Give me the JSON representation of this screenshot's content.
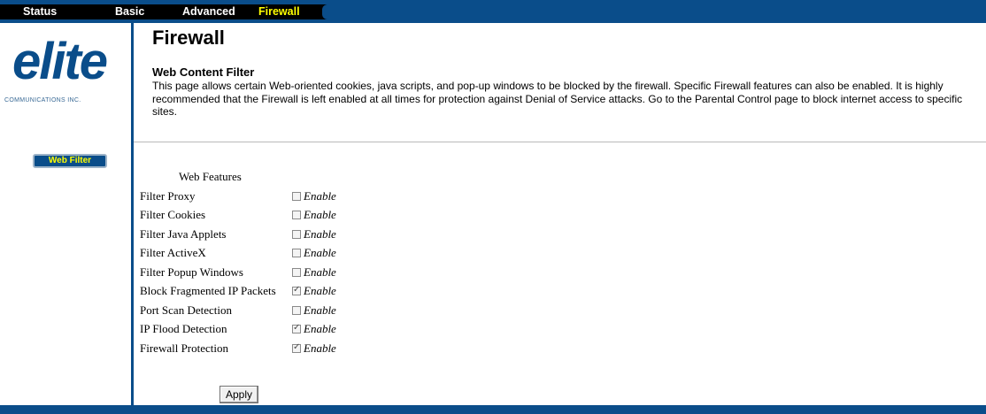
{
  "nav": {
    "tabs": [
      {
        "label": "Status"
      },
      {
        "label": "Basic"
      },
      {
        "label": "Advanced"
      },
      {
        "label": "Firewall"
      }
    ],
    "active_tab": "Firewall"
  },
  "logo": {
    "word": "elite",
    "subtitle": "COMMUNICATIONS INC."
  },
  "sidebar": {
    "items": [
      {
        "label": "Web Filter"
      }
    ]
  },
  "main": {
    "page_title": "Firewall",
    "section_title": "Web Content Filter",
    "section_description": "This page allows certain Web-oriented cookies, java scripts, and pop-up windows to be blocked by the firewall.  Specific Firewall features can also be enabled. It is highly recommended that the Firewall is left enabled at all times for protection against Denial of Service attacks. Go to the Parental Control page to block internet access to specific sites."
  },
  "form": {
    "header": "Web Features",
    "rows": [
      {
        "label": "Filter Proxy",
        "option": "Enable",
        "checked": false
      },
      {
        "label": "Filter Cookies",
        "option": "Enable",
        "checked": false
      },
      {
        "label": "Filter Java Applets",
        "option": "Enable",
        "checked": false
      },
      {
        "label": "Filter ActiveX",
        "option": "Enable",
        "checked": false
      },
      {
        "label": "Filter Popup Windows",
        "option": "Enable",
        "checked": false
      },
      {
        "label": "Block Fragmented IP Packets",
        "option": "Enable",
        "checked": true
      },
      {
        "label": "Port Scan Detection",
        "option": "Enable",
        "checked": false
      },
      {
        "label": "IP Flood Detection",
        "option": "Enable",
        "checked": true
      },
      {
        "label": "Firewall Protection",
        "option": "Enable",
        "checked": true
      }
    ],
    "apply_label": "Apply"
  },
  "colors": {
    "brand_blue": "#0a4d8a",
    "active_tab": "#ffff00",
    "tab_strip": "#000000"
  }
}
